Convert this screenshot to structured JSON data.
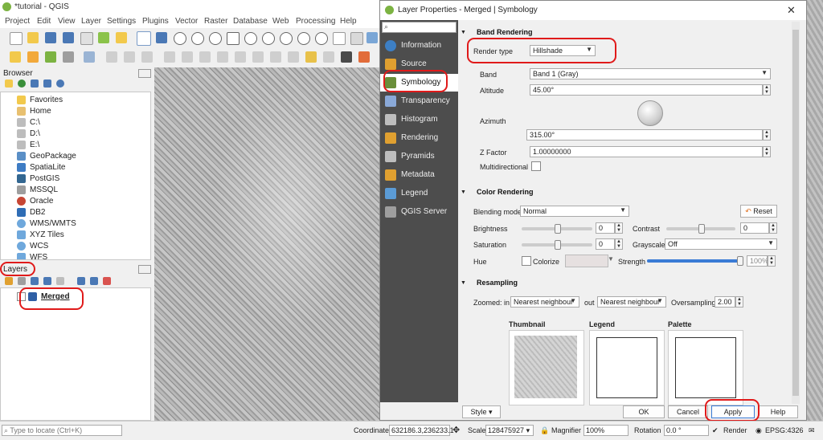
{
  "main_window": {
    "title": "*tutorial - QGIS",
    "menu": [
      "Project",
      "Edit",
      "View",
      "Layer",
      "Settings",
      "Plugins",
      "Vector",
      "Raster",
      "Database",
      "Web",
      "Processing",
      "Help"
    ]
  },
  "browser": {
    "title": "Browser",
    "items": [
      "Favorites",
      "Home",
      "C:\\",
      "D:\\",
      "E:\\",
      "GeoPackage",
      "SpatiaLite",
      "PostGIS",
      "MSSQL",
      "Oracle",
      "DB2",
      "WMS/WMTS",
      "XYZ Tiles",
      "WCS",
      "WFS"
    ]
  },
  "layers": {
    "title": "Layers",
    "items": [
      {
        "name": "Merged",
        "checked": true
      }
    ]
  },
  "dialog": {
    "title": "Layer Properties - Merged | Symbology",
    "search_placeholder": "",
    "nav": [
      "Information",
      "Source",
      "Symbology",
      "Transparency",
      "Histogram",
      "Rendering",
      "Pyramids",
      "Metadata",
      "Legend",
      "QGIS Server"
    ],
    "selected_nav": "Symbology",
    "band_rendering": {
      "section": "Band Rendering",
      "render_type_label": "Render type",
      "render_type": "Hillshade",
      "band_label": "Band",
      "band": "Band 1 (Gray)",
      "altitude_label": "Altitude",
      "altitude": "45.00°",
      "azimuth_label": "Azimuth",
      "azimuth": "315.00°",
      "zfactor_label": "Z Factor",
      "zfactor": "1.00000000",
      "multidirectional_label": "Multidirectional",
      "multidirectional": false
    },
    "color_rendering": {
      "section": "Color Rendering",
      "blending_label": "Blending mode",
      "blending": "Normal",
      "reset": "Reset",
      "brightness_label": "Brightness",
      "brightness": "0",
      "brightness_pos": 0.5,
      "contrast_label": "Contrast",
      "contrast": "0",
      "contrast_pos": 0.5,
      "saturation_label": "Saturation",
      "saturation": "0",
      "saturation_pos": 0.5,
      "grayscale_label": "Grayscale",
      "grayscale": "Off",
      "hue_label": "Hue",
      "colorize_label": "Colorize",
      "strength_label": "Strength",
      "strength": "100%",
      "strength_pos": 1.0
    },
    "resampling": {
      "section": "Resampling",
      "zoomed_in_label": "Zoomed: in",
      "zoomed_in": "Nearest neighbour",
      "out_label": "out",
      "zoomed_out": "Nearest neighbour",
      "oversampling_label": "Oversampling",
      "oversampling": "2.00"
    },
    "previews": {
      "thumbnail": "Thumbnail",
      "legend": "Legend",
      "palette": "Palette"
    },
    "buttons": {
      "style": "Style",
      "ok": "OK",
      "cancel": "Cancel",
      "apply": "Apply",
      "help": "Help"
    }
  },
  "statusbar": {
    "locate_placeholder": "Type to locate (Ctrl+K)",
    "coordinate_label": "Coordinate",
    "coordinate": "632186.3,236233.1",
    "scale_label": "Scale",
    "scale": "128475927",
    "magnifier_label": "Magnifier",
    "magnifier": "100%",
    "rotation_label": "Rotation",
    "rotation": "0.0 °",
    "render_label": "Render",
    "crs": "EPSG:4326"
  },
  "colors": {
    "highlight": "#e01a1a",
    "sidebar": "#4d4d4d",
    "accent": "#3a7bd5"
  }
}
